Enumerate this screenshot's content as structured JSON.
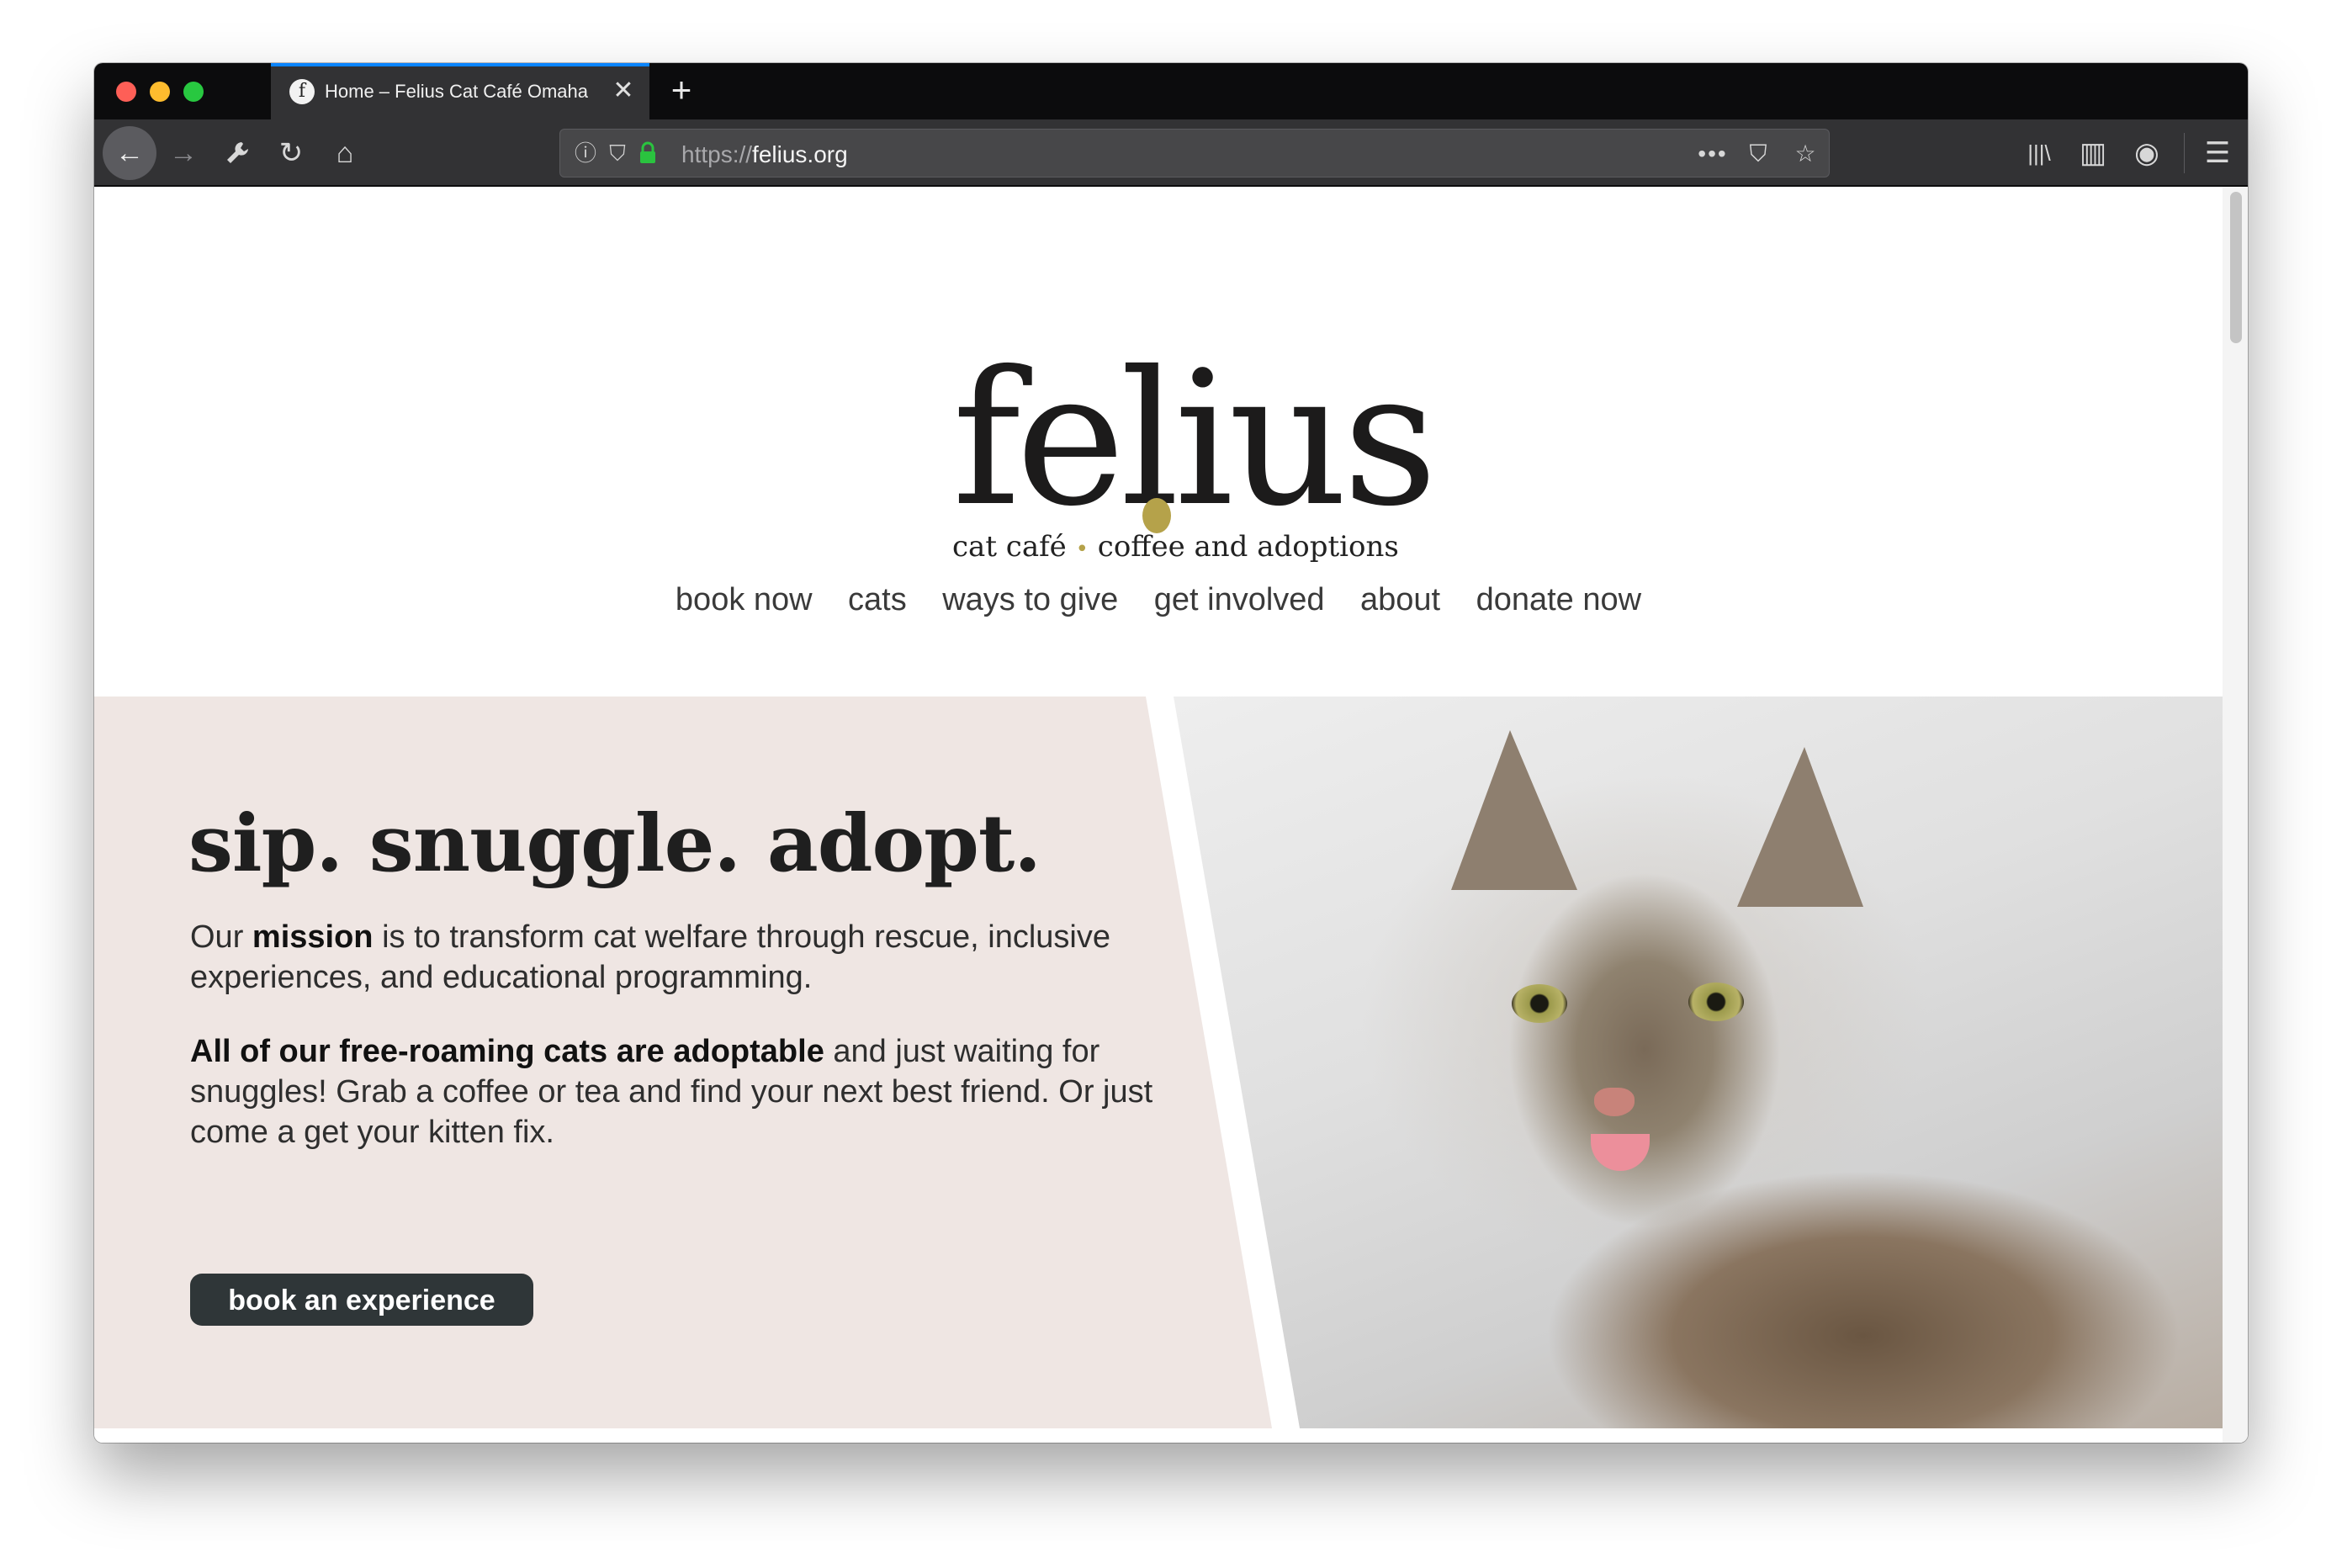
{
  "browser": {
    "tab": {
      "favicon_letter": "f",
      "title": "Home – Felius Cat Café Omaha",
      "close_glyph": "✕"
    },
    "new_tab_glyph": "+",
    "toolbar": {
      "back_glyph": "←",
      "forward_glyph": "→",
      "tools_glyph": "🔧",
      "reload_glyph": "↻",
      "home_glyph": "⌂",
      "library_glyph": "|||\\",
      "sidebar_glyph": "▥",
      "account_glyph": "◉",
      "menu_glyph": "☰"
    },
    "urlbar": {
      "info_glyph": "ⓘ",
      "shield_glyph": "⛉",
      "lock_glyph": "🔒",
      "scheme": "https://",
      "host": "felius.org",
      "more_glyph": "•••",
      "pocket_glyph": "⛉",
      "star_glyph": "☆"
    },
    "colors": {
      "tab_accent": "#0a84ff",
      "toolbar_bg": "#323234",
      "lock_green": "#2ac33f"
    }
  },
  "site": {
    "logo": {
      "wordmark": "felius",
      "tagline_left": "cat café",
      "tagline_dot": "•",
      "tagline_right": "coffee and adoptions",
      "accent_color": "#b5a24a"
    },
    "nav": [
      {
        "label": "book now"
      },
      {
        "label": "cats"
      },
      {
        "label": "ways to give"
      },
      {
        "label": "get involved"
      },
      {
        "label": "about"
      },
      {
        "label": "donate now"
      }
    ],
    "hero": {
      "headline": "sip. snuggle. adopt.",
      "p1_pre": "Our ",
      "p1_bold": "mission",
      "p1_post": " is to transform cat welfare through rescue, inclusive experiences, and educational programming.",
      "p2_bold": "All of our free-roaming cats are adoptable",
      "p2_post": " and just waiting for snuggles! Grab a coffee or tea and find your next best friend. Or just come a get your kitten fix.",
      "cta_label": "book an experience",
      "panel_color": "#efe6e3",
      "cta_color": "#2f3638"
    }
  },
  "icons": [
    "back-arrow-icon",
    "forward-arrow-icon",
    "wrench-icon",
    "reload-icon",
    "home-icon",
    "info-icon",
    "tracking-shield-icon",
    "lock-icon",
    "page-actions-icon",
    "pocket-icon",
    "bookmark-star-icon",
    "library-icon",
    "sidebar-icon",
    "account-icon",
    "hamburger-menu-icon"
  ]
}
